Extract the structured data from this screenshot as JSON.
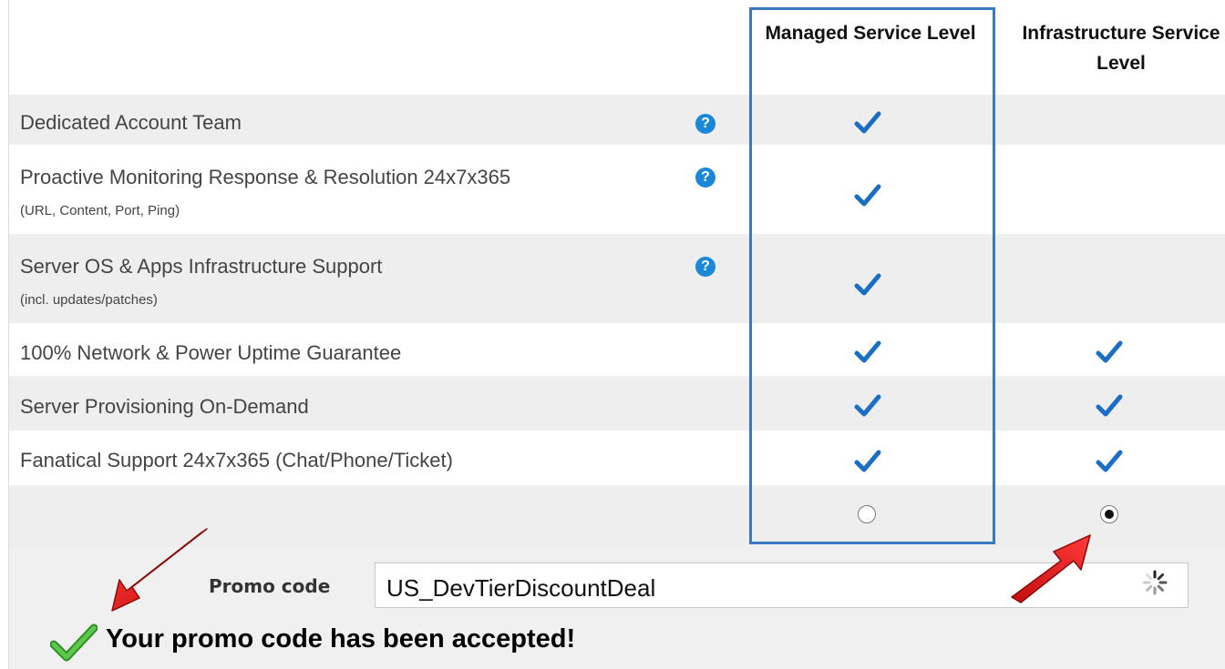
{
  "header": {
    "managed_label": "Managed Service Level",
    "infrastructure_label": "Infrastructure Service Level"
  },
  "features": [
    {
      "label": "Dedicated Account Team",
      "sub": "",
      "help": true,
      "managed": true,
      "infrastructure": false
    },
    {
      "label": "Proactive Monitoring Response & Resolution 24x7x365",
      "sub": "(URL, Content, Port, Ping)",
      "help": true,
      "managed": true,
      "infrastructure": false
    },
    {
      "label": "Server OS & Apps Infrastructure Support",
      "sub": "(incl. updates/patches)",
      "help": true,
      "managed": true,
      "infrastructure": false
    },
    {
      "label": "100% Network & Power Uptime Guarantee",
      "sub": "",
      "help": false,
      "managed": true,
      "infrastructure": true
    },
    {
      "label": "Server Provisioning On-Demand",
      "sub": "",
      "help": false,
      "managed": true,
      "infrastructure": true
    },
    {
      "label": "Fanatical Support 24x7x365 (Chat/Phone/Ticket)",
      "sub": "",
      "help": false,
      "managed": true,
      "infrastructure": true
    }
  ],
  "selection": {
    "managed_selected": false,
    "infrastructure_selected": true
  },
  "promo": {
    "label": "Promo code",
    "value": "US_DevTierDiscountDeal",
    "accepted_message": "Your promo code has been accepted!"
  },
  "help_glyph": "?",
  "colors": {
    "check_blue": "#1a6fc4",
    "highlight_border": "#3a78c1",
    "help_blue": "#1a87d8",
    "arrow_red": "#e01b1b",
    "accept_green": "#3aa52e"
  },
  "icons": {
    "check": "check-icon",
    "help": "help-icon",
    "spinner": "loading-spinner-icon",
    "success": "success-check-icon",
    "arrow": "red-arrow-icon"
  }
}
